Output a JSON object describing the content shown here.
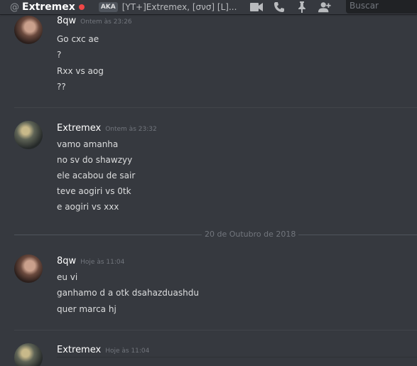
{
  "header": {
    "at_symbol": "@",
    "channel_name": "Extremex",
    "status_color": "#f04747",
    "aka_label": "AKA",
    "nicknames": "[YT+]Extremex, [σνσ] [L]...",
    "icons": [
      "video-call-icon",
      "voice-call-icon",
      "pin-icon",
      "add-friend-icon"
    ],
    "search_placeholder": "Buscar"
  },
  "messages": [
    {
      "author": "8qw",
      "timestamp": "Ontem às 23:26",
      "lines": [
        "Go cxc ae",
        "?",
        "Rxx vs aog",
        "??"
      ]
    },
    {
      "author": "Extremex",
      "timestamp": "Ontem às 23:32",
      "lines": [
        "vamo amanha",
        "no sv do shawzyy",
        "ele acabou de sair",
        "teve aogiri vs 0tk",
        "e aogiri vs xxx"
      ]
    },
    {
      "author": "8qw",
      "timestamp": "Hoje às 11:04",
      "lines": [
        "eu vi",
        "ganhamo d a otk dsahazduashdu",
        "quer marca hj"
      ]
    },
    {
      "author": "Extremex",
      "timestamp": "Hoje às 11:04",
      "lines": []
    }
  ],
  "date_divider": "20 de Outubro de 2018"
}
